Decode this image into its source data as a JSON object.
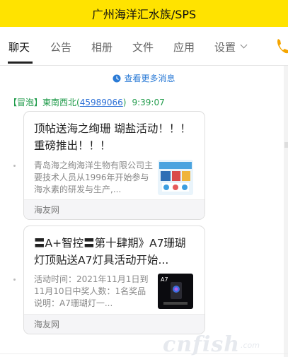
{
  "window": {
    "title": "广州海洋汇水族/SPS"
  },
  "tabs": [
    {
      "label": "聊天",
      "active": true
    },
    {
      "label": "公告"
    },
    {
      "label": "相册"
    },
    {
      "label": "文件"
    },
    {
      "label": "应用"
    },
    {
      "label": "设置"
    }
  ],
  "icons": {
    "phone": "phone-icon",
    "clock": "clock-icon",
    "chevron": "chevron-down-icon"
  },
  "colors": {
    "titlebar": "#ffe300",
    "sender": "#1f9b4a",
    "link": "#2b7bd6"
  },
  "chat": {
    "more_messages": "查看更多消息",
    "sender_prefix": "【冒泡】東南西北(",
    "sender_qq": "45989066",
    "sender_suffix": ")",
    "time": "9:39:07",
    "cards": [
      {
        "title": "顶帖送海之绚珊 瑚盐活动！！！ 重磅推出！！！",
        "desc": "青岛海之绚海洋生物有限公司主要技术人员从1996年开始参与海水素的研发与生产,...",
        "source": "海友网"
      },
      {
        "title": "〓A+智控〓第十肆期》A7珊瑚灯顶贴送A7灯具活动开始...",
        "desc": "活动时间：2021年11月1日到11月10日中奖人数：1名奖品说明：A7珊瑚灯一...",
        "source": "海友网"
      }
    ]
  },
  "watermark": {
    "text": "cnfish",
    "sub": ".com"
  }
}
